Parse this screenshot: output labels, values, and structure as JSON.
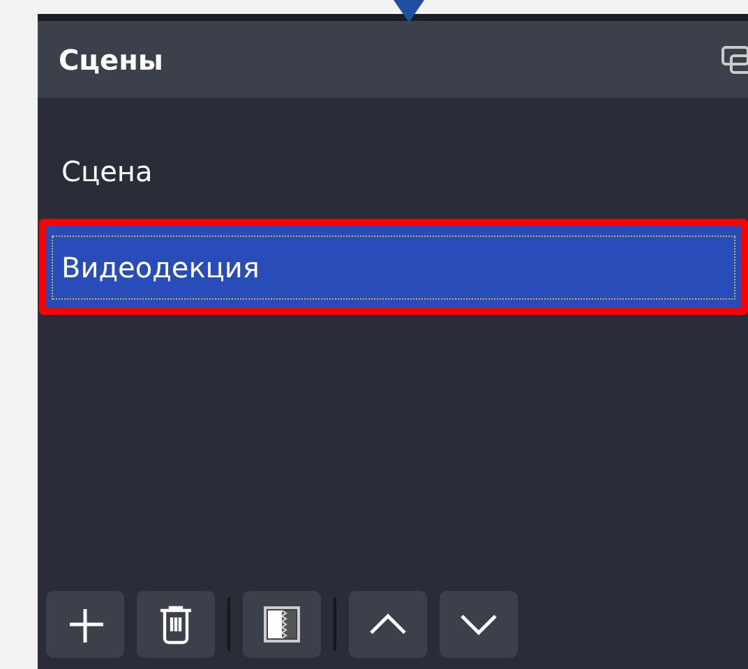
{
  "panel": {
    "title": "Сцены"
  },
  "scenes": [
    {
      "label": "Сцена",
      "selected": false,
      "highlighted": false
    },
    {
      "label": "Видеодекция",
      "selected": true,
      "highlighted": true
    }
  ],
  "toolbar": [
    {
      "kind": "add"
    },
    {
      "kind": "remove"
    },
    {
      "kind": "separator"
    },
    {
      "kind": "filters"
    },
    {
      "kind": "separator"
    },
    {
      "kind": "up"
    },
    {
      "kind": "down"
    }
  ]
}
